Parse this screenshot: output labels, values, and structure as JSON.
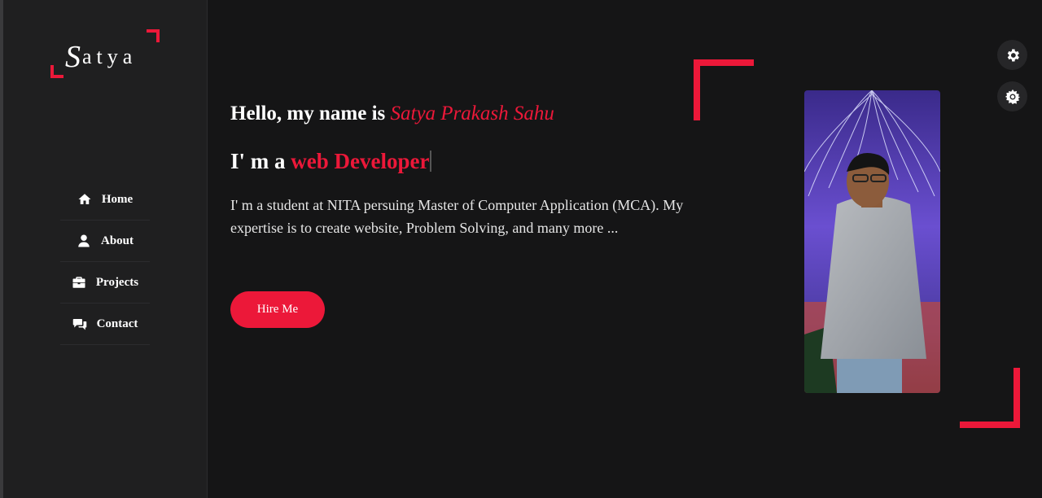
{
  "logo": {
    "first_letter": "S",
    "rest": "atya"
  },
  "sidebar": {
    "items": [
      {
        "label": "Home",
        "icon": "home-icon"
      },
      {
        "label": "About",
        "icon": "user-icon"
      },
      {
        "label": "Projects",
        "icon": "briefcase-icon"
      },
      {
        "label": "Contact",
        "icon": "chat-icon"
      }
    ]
  },
  "hero": {
    "greeting": "Hello, my name is ",
    "name": "Satya Prakash Sahu",
    "role_prefix": "I' m a ",
    "role_highlight": "web Developer",
    "description": "I' m a student at NITA persuing Master of Computer Application (MCA). My expertise is to create website, Problem Solving, and many more ...",
    "button_label": "Hire Me"
  },
  "floating": {
    "settings_icon": "gear-icon",
    "theme_icon": "sun-icon"
  },
  "colors": {
    "accent": "#ec1839",
    "background": "#151516",
    "sidebar": "#1f1f20"
  }
}
